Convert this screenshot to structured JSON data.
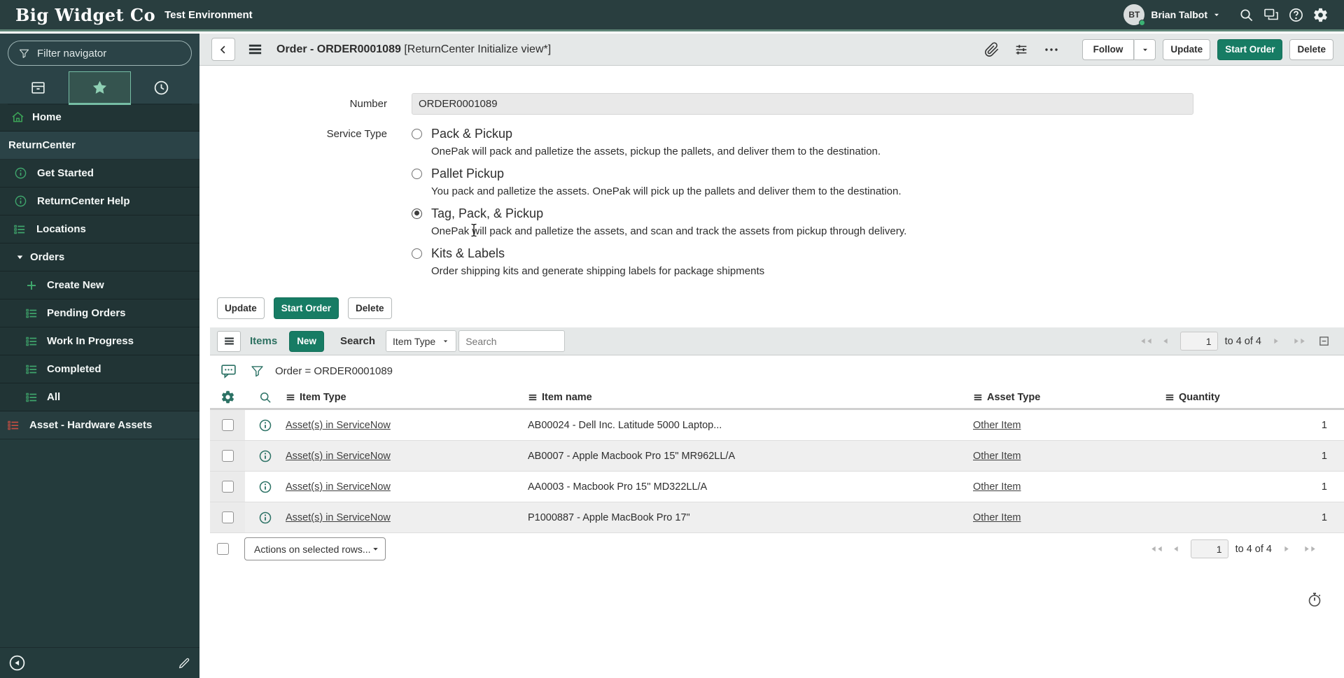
{
  "brand": {
    "logo": "Big Widget Co",
    "environment": "Test Environment"
  },
  "topbar": {
    "user_initials": "BT",
    "user_name": "Brian Talbot"
  },
  "sidebar": {
    "filter_placeholder": "Filter navigator",
    "tabs": [
      "all-applications",
      "favorites",
      "history"
    ],
    "items": [
      {
        "label": "Home"
      },
      {
        "label": "ReturnCenter"
      },
      {
        "label": "Get Started"
      },
      {
        "label": "ReturnCenter Help"
      },
      {
        "label": "Locations"
      },
      {
        "label": "Orders"
      },
      {
        "label": "Create New"
      },
      {
        "label": "Pending Orders"
      },
      {
        "label": "Work In Progress"
      },
      {
        "label": "Completed"
      },
      {
        "label": "All"
      },
      {
        "label": "Asset - Hardware Assets"
      }
    ]
  },
  "form_header": {
    "title": "Order - ORDER0001089",
    "view_suffix": "[ReturnCenter Initialize view*]",
    "follow_label": "Follow",
    "update_label": "Update",
    "start_order_label": "Start Order",
    "delete_label": "Delete"
  },
  "form": {
    "number_label": "Number",
    "number_value": "ORDER0001089",
    "service_type_label": "Service Type",
    "options": [
      {
        "label": "Pack & Pickup",
        "description": "OnePak will pack and palletize the assets, pickup the pallets, and deliver them to the destination.",
        "selected": false
      },
      {
        "label": "Pallet Pickup",
        "description": "You pack and palletize the assets. OnePak will pick up the pallets and deliver them to the destination.",
        "selected": false
      },
      {
        "label": "Tag, Pack, & Pickup",
        "description": "OnePak will pack and palletize the assets, and scan and track the assets from pickup through delivery.",
        "selected": true
      },
      {
        "label": "Kits & Labels",
        "description": "Order shipping kits and generate shipping labels for package shipments",
        "selected": false
      }
    ],
    "update_label": "Update",
    "start_order_label": "Start Order",
    "delete_label": "Delete"
  },
  "list": {
    "title": "Items",
    "new_label": "New",
    "search_label": "Search",
    "search_field": "Item Type",
    "search_placeholder": "Search",
    "breadcrumb": "Order = ORDER0001089",
    "pagination": {
      "page": "1",
      "range": "to 4 of 4"
    },
    "columns": [
      "Item Type",
      "Item name",
      "Asset Type",
      "Quantity"
    ],
    "rows": [
      {
        "item_type": "Asset(s) in ServiceNow",
        "item_name": "AB00024 - Dell Inc. Latitude 5000 Laptop...",
        "asset_type": "Other Item",
        "quantity": "1"
      },
      {
        "item_type": "Asset(s) in ServiceNow",
        "item_name": "AB0007 - Apple Macbook Pro 15\" MR962LL/A",
        "asset_type": "Other Item",
        "quantity": "1"
      },
      {
        "item_type": "Asset(s) in ServiceNow",
        "item_name": "AA0003 - Macbook Pro 15'' MD322LL/A",
        "asset_type": "Other Item",
        "quantity": "1"
      },
      {
        "item_type": "Asset(s) in ServiceNow",
        "item_name": "P1000887 - Apple MacBook Pro 17\"",
        "asset_type": "Other Item",
        "quantity": "1"
      }
    ],
    "actions_placeholder": "Actions on selected rows..."
  }
}
